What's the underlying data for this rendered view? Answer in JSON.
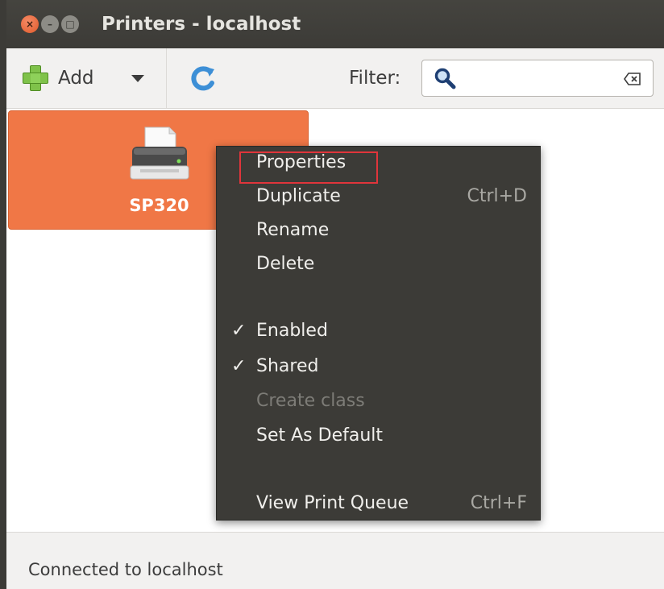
{
  "window": {
    "title": "Printers - localhost",
    "buttons": {
      "close": "×",
      "minimize": "–",
      "maximize": "□"
    }
  },
  "toolbar": {
    "add_label": "Add",
    "filter_label": "Filter:",
    "filter_value": "",
    "icons": {
      "add": "green-plus-icon",
      "dropdown": "chevron-down-icon",
      "refresh": "refresh-icon",
      "search": "search-icon",
      "clear": "clear-icon"
    }
  },
  "printers": [
    {
      "name": "SP320",
      "selected": true,
      "icon": "printer-icon"
    }
  ],
  "context_menu": {
    "items": [
      {
        "label": "Properties",
        "accel": "",
        "checked": false,
        "enabled": true,
        "highlighted": true
      },
      {
        "label": "Duplicate",
        "accel": "Ctrl+D",
        "checked": false,
        "enabled": true
      },
      {
        "label": "Rename",
        "accel": "",
        "checked": false,
        "enabled": true
      },
      {
        "label": "Delete",
        "accel": "",
        "checked": false,
        "enabled": true
      },
      {
        "label": "Enabled",
        "accel": "",
        "checked": true,
        "enabled": true
      },
      {
        "label": "Shared",
        "accel": "",
        "checked": true,
        "enabled": true
      },
      {
        "label": "Create class",
        "accel": "",
        "checked": false,
        "enabled": false
      },
      {
        "label": "Set As Default",
        "accel": "",
        "checked": false,
        "enabled": true
      },
      {
        "label": "View Print Queue",
        "accel": "Ctrl+F",
        "checked": false,
        "enabled": true
      }
    ],
    "check_glyph": "✓"
  },
  "status": {
    "text": "Connected to localhost"
  },
  "colors": {
    "titlebar": "#3c3b37",
    "selection": "#f07746",
    "menu_bg": "#3c3b37",
    "highlight_outline": "#e0353b"
  }
}
